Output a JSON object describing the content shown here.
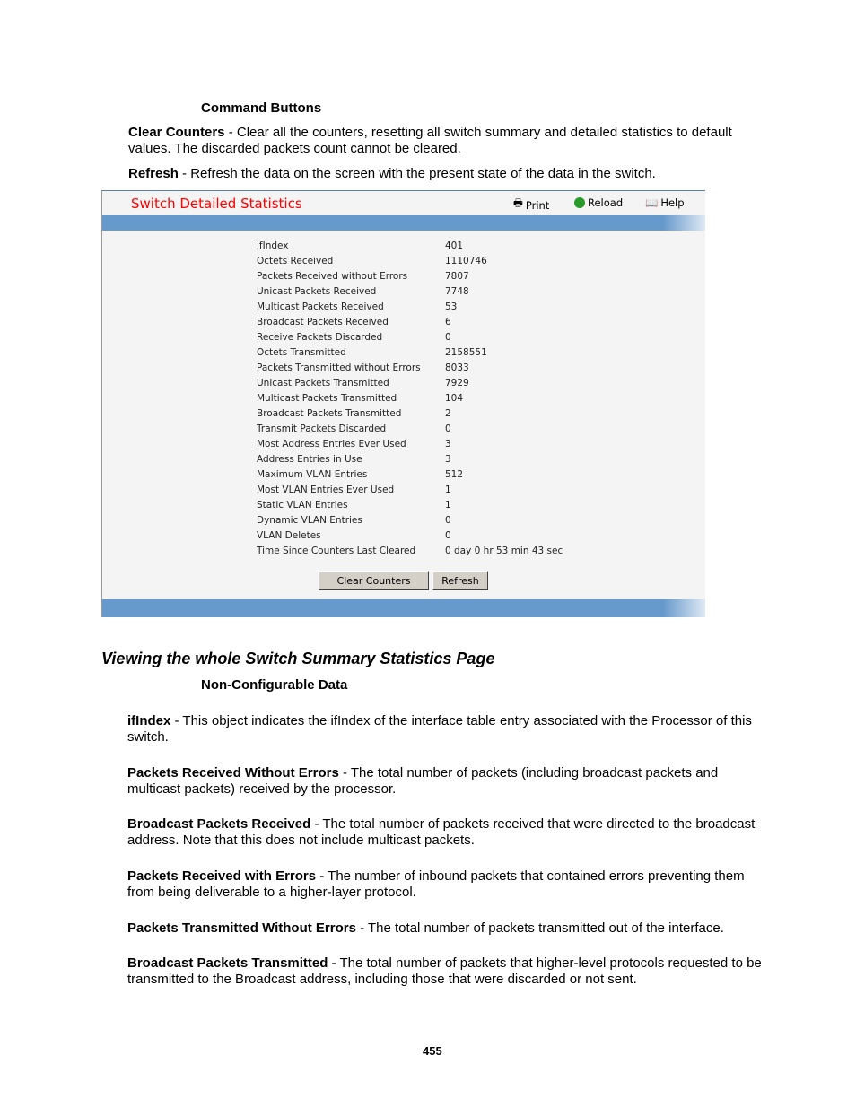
{
  "command_heading": "Command Buttons",
  "cmd_items": [
    {
      "term": "Clear Counters",
      "desc": " - Clear all the counters, resetting all switch summary and detailed statistics to default values. The discarded packets count cannot be cleared."
    },
    {
      "term": "Refresh",
      "desc": " - Refresh the data on the screen with the present state of the data in the switch."
    }
  ],
  "screenshot": {
    "title": "Switch Detailed Statistics",
    "toolbar": {
      "print": "Print",
      "reload": "Reload",
      "help": "Help"
    },
    "rows": [
      {
        "label": "ifIndex",
        "value": "401"
      },
      {
        "label": "Octets Received",
        "value": "1110746"
      },
      {
        "label": "Packets Received without Errors",
        "value": "7807"
      },
      {
        "label": "Unicast Packets Received",
        "value": "7748"
      },
      {
        "label": "Multicast Packets Received",
        "value": "53"
      },
      {
        "label": "Broadcast Packets Received",
        "value": "6"
      },
      {
        "label": "Receive Packets Discarded",
        "value": "0"
      },
      {
        "label": "Octets Transmitted",
        "value": "2158551"
      },
      {
        "label": "Packets Transmitted without Errors",
        "value": "8033"
      },
      {
        "label": "Unicast Packets Transmitted",
        "value": "7929"
      },
      {
        "label": "Multicast Packets Transmitted",
        "value": "104"
      },
      {
        "label": "Broadcast Packets Transmitted",
        "value": "2"
      },
      {
        "label": "Transmit Packets Discarded",
        "value": "0"
      },
      {
        "label": "Most Address Entries Ever Used",
        "value": "3"
      },
      {
        "label": "Address Entries in Use",
        "value": "3"
      },
      {
        "label": "Maximum VLAN Entries",
        "value": "512"
      },
      {
        "label": "Most VLAN Entries Ever Used",
        "value": "1"
      },
      {
        "label": "Static VLAN Entries",
        "value": "1"
      },
      {
        "label": "Dynamic VLAN Entries",
        "value": "0"
      },
      {
        "label": "VLAN Deletes",
        "value": "0"
      },
      {
        "label": "Time Since Counters Last Cleared",
        "value": "0 day 0 hr 53 min 43 sec"
      }
    ],
    "buttons": {
      "clear": "Clear Counters",
      "refresh": "Refresh"
    },
    "colors": {
      "title": "#ff0000",
      "bar": "#6699cc",
      "panel": "#f4f4f4"
    }
  },
  "section_heading": "Viewing the whole Switch Summary Statistics Page",
  "noncfg_heading": "Non-Configurable Data",
  "defs": [
    {
      "term": "ifIndex",
      "desc": " - This object indicates the ifIndex of the interface table entry associated with the Processor of this switch."
    },
    {
      "term": "Packets Received Without Errors",
      "desc": " - The total number of packets (including broadcast packets and multicast packets) received by the processor."
    },
    {
      "term": "Broadcast Packets Received",
      "desc": " - The total number of packets received that were directed to the broadcast address. Note that this does not include multicast packets."
    },
    {
      "term": "Packets Received with Errors",
      "desc": " - The number of inbound packets that contained errors preventing them from being deliverable to a higher-layer protocol."
    },
    {
      "term": "Packets Transmitted Without Errors",
      "desc": " - The total number of packets transmitted out of the interface."
    },
    {
      "term": "Broadcast Packets Transmitted",
      "desc": " - The total number of packets that higher-level protocols requested to be transmitted to the Broadcast address, including those that were discarded or not sent."
    }
  ],
  "page_number": "455"
}
